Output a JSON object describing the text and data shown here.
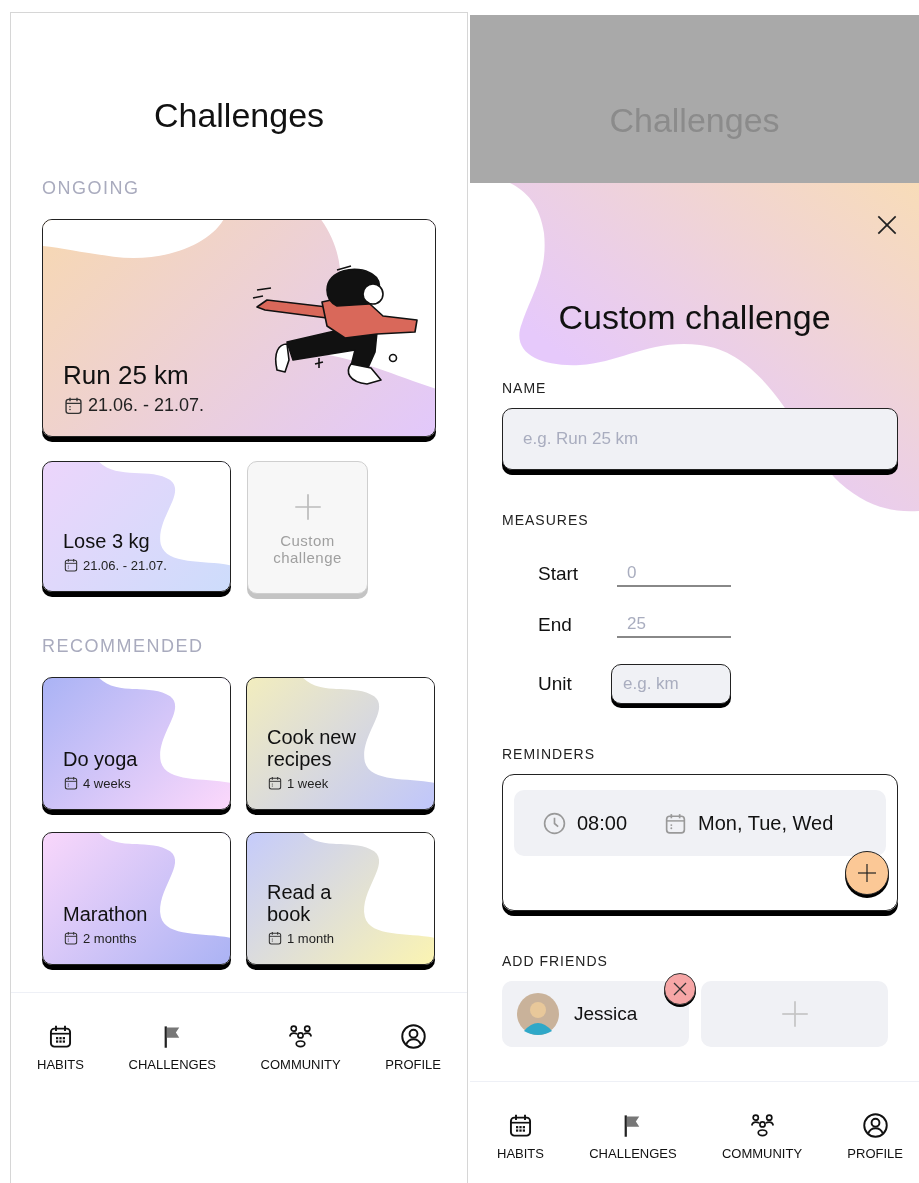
{
  "challenges_screen": {
    "title": "Challenges",
    "sections": [
      {
        "heading": "ONGOING",
        "cards": [
          {
            "kind": "featured",
            "title": "Run 25 km",
            "duration": "21.06. - 21.07."
          },
          {
            "kind": "small",
            "title": "Lose 3 kg",
            "duration": "21.06. - 21.07."
          },
          {
            "kind": "add",
            "title": "Custom challenge"
          }
        ]
      },
      {
        "heading": "RECOMMENDED",
        "cards": [
          {
            "kind": "small",
            "title": "Do yoga",
            "duration": "4 weeks"
          },
          {
            "kind": "small",
            "title": "Cook new recipes",
            "duration": "1 week"
          },
          {
            "kind": "small",
            "title": "Marathon",
            "duration": "2 months"
          },
          {
            "kind": "small",
            "title": "Read a book",
            "duration": "1 month"
          }
        ]
      }
    ],
    "nav": [
      {
        "label": "HABITS"
      },
      {
        "label": "CHALLENGES"
      },
      {
        "label": "COMMUNITY"
      },
      {
        "label": "PROFILE"
      }
    ]
  },
  "custom_challenge_screen": {
    "background_screen": {
      "title": "Challenges"
    },
    "title": "Custom challenge",
    "name": {
      "label": "NAME",
      "placeholder": "e.g. Run 25 km"
    },
    "measures": {
      "label": "MEASURES",
      "fields": [
        {
          "label": "Start",
          "placeholder": "0",
          "kind": "line"
        },
        {
          "label": "End",
          "placeholder": "25",
          "kind": "line"
        },
        {
          "label": "Unit",
          "placeholder": "e.g. km",
          "kind": "box"
        }
      ]
    },
    "reminders": {
      "label": "REMINDERS",
      "items": [
        {
          "time": "08:00",
          "days": "Mon, Tue, Wed"
        }
      ]
    },
    "friends": {
      "label": "ADD FRIENDS",
      "items": [
        {
          "name": "Jessica"
        }
      ]
    },
    "nav": [
      {
        "label": "HABITS"
      },
      {
        "label": "CHALLENGES"
      },
      {
        "label": "COMMUNITY"
      },
      {
        "label": "PROFILE"
      }
    ]
  }
}
